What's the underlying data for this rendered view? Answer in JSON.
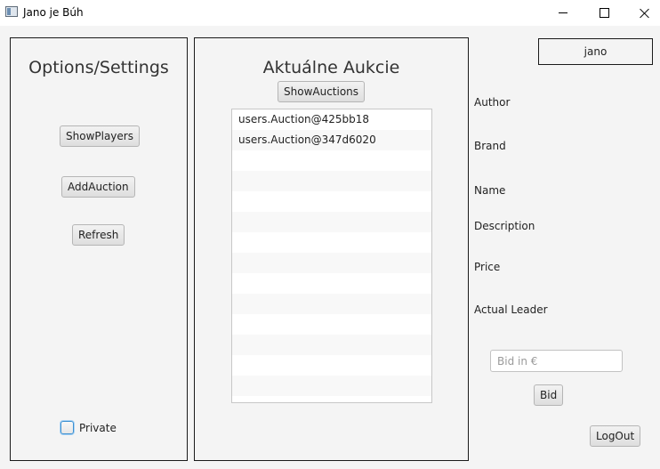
{
  "window": {
    "title": "Jano je Búh",
    "icons": {
      "app": "app-window-icon",
      "minimize": "minimize-icon",
      "maximize": "maximize-icon",
      "close": "close-icon"
    }
  },
  "left_panel": {
    "title": "Options/Settings",
    "buttons": {
      "show_players": "ShowPlayers",
      "add_auction": "AddAuction",
      "refresh": "Refresh"
    },
    "private_checkbox": {
      "label": "Private",
      "checked": false
    }
  },
  "middle_panel": {
    "title": "Aktuálne Aukcie",
    "show_auctions_button": "ShowAuctions",
    "auctions": [
      "users.Auction@425bb18",
      "users.Auction@347d6020",
      "",
      "",
      "",
      "",
      "",
      "",
      "",
      "",
      "",
      "",
      "",
      ""
    ]
  },
  "right_panel": {
    "username": "jano",
    "labels": {
      "author": "Author",
      "brand": "Brand",
      "name": "Name",
      "description": "Description",
      "price": "Price",
      "actual_leader": "Actual Leader"
    },
    "bid_input": {
      "placeholder": "Bid in €",
      "value": ""
    },
    "bid_button": "Bid",
    "logout_button": "LogOut"
  },
  "colors": {
    "background": "#f4f4f4",
    "titlebar": "#ffffff",
    "panel_border": "#1a1a1a",
    "checkbox_focus": "#3a8fd1"
  }
}
